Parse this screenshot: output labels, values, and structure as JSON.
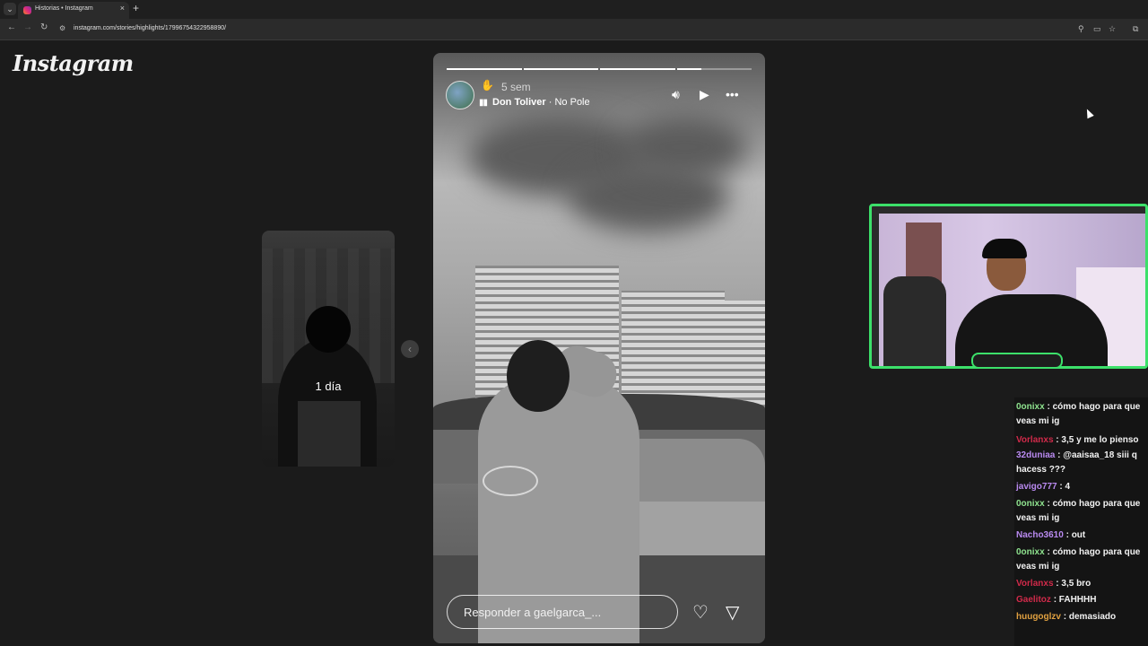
{
  "browser": {
    "tab_title": "Historias • Instagram",
    "url": "instagram.com/stories/highlights/17996754322958890/"
  },
  "app": {
    "logo_text": "Instagram"
  },
  "prev_story": {
    "time_label": "1 día"
  },
  "story": {
    "time": "5 sem",
    "music_artist": "Don Toliver",
    "music_separator": " · ",
    "music_song": "No Pole",
    "reply_placeholder": "Responder a gaelgarca_...",
    "progress": [
      1.0,
      1.0,
      1.0,
      0.33
    ]
  },
  "chat": {
    "messages": [
      {
        "user": "0onixx",
        "color": "#8fe38f",
        "text": ": cómo hago para que veas mi ig"
      },
      {
        "user": "Vorlanxs",
        "color": "#d12a4a",
        "text": ": 3,5 y me lo pienso"
      },
      {
        "user": "32duniaa",
        "color": "#b98af0",
        "text": ": @aaisaa_18 siii q hacess ???"
      },
      {
        "user": "javigo777",
        "color": "#b98af0",
        "text": ": 4"
      },
      {
        "user": "0onixx",
        "color": "#8fe38f",
        "text": ": cómo hago para que veas mi ig"
      },
      {
        "user": "Nacho3610",
        "color": "#b98af0",
        "text": ": out"
      },
      {
        "user": "0onixx",
        "color": "#8fe38f",
        "text": ": cómo hago para que veas mi ig"
      },
      {
        "user": "Vorlanxs",
        "color": "#d12a4a",
        "text": ": 3,5 bro"
      },
      {
        "user": "Gaelitoz",
        "color": "#d12a4a",
        "text": ": FAHHHH"
      },
      {
        "user": "huugoglzv",
        "color": "#e0a040",
        "text": ": demasiado"
      }
    ]
  }
}
